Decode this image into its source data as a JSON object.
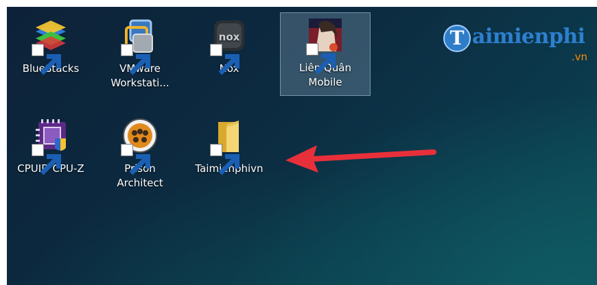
{
  "desktop": {
    "icons": [
      {
        "label_lines": [
          "BlueStacks"
        ],
        "icon": "bluestacks-icon"
      },
      {
        "label_lines": [
          "VMware",
          "Workstati..."
        ],
        "icon": "vmware-icon"
      },
      {
        "label_lines": [
          "Nox"
        ],
        "icon": "nox-icon"
      },
      {
        "label_lines": [
          "Liên Quân",
          "Mobile"
        ],
        "icon": "lien-quan-icon",
        "selected": true
      },
      {
        "label_lines": [
          "CPUID CPU-Z"
        ],
        "icon": "cpuz-icon"
      },
      {
        "label_lines": [
          "Prison",
          "Architect"
        ],
        "icon": "prison-architect-icon"
      },
      {
        "label_lines": [
          "Taimienphivn"
        ],
        "icon": "folder-icon"
      }
    ]
  },
  "watermark": {
    "initial": "T",
    "word": "aimienphi",
    "tld": ".vn"
  },
  "annotation": {
    "arrow_color": "#e8303a",
    "points_to": "Taimienphivn"
  },
  "colors": {
    "desktop_bg": "#0c2a40",
    "label_text": "#ffffff",
    "selection": "#a0bed7"
  }
}
